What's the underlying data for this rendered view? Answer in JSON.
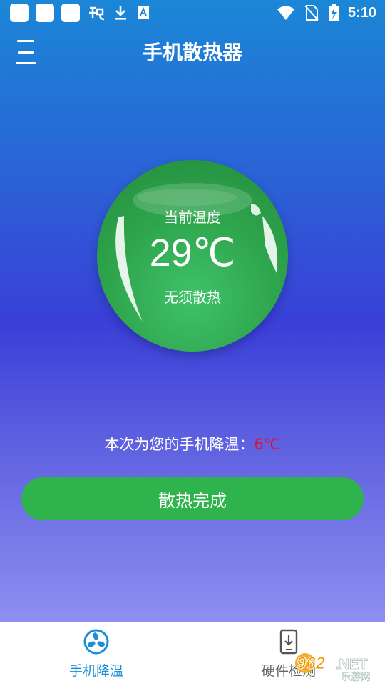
{
  "status_bar": {
    "time": "5:10",
    "left_icons": [
      "notification-box-icon",
      "notification-box-icon",
      "notification-box-icon",
      "bug-icon",
      "download-icon",
      "text-a-icon"
    ],
    "right_icons": [
      "wifi-icon",
      "no-sim-icon",
      "battery-charging-icon"
    ]
  },
  "header": {
    "title": "手机散热器",
    "menu_icon": "menu-icon"
  },
  "ball": {
    "label": "当前温度",
    "temperature": "29℃",
    "status": "无须散热"
  },
  "result": {
    "prefix": "本次为您的手机降温：",
    "value": "6℃",
    "value_color": "#e2102a"
  },
  "action": {
    "button_label": "散热完成",
    "button_color": "#2fb34c"
  },
  "bottom_nav": {
    "items": [
      {
        "label": "手机降温",
        "icon": "fan-icon",
        "active": true
      },
      {
        "label": "硬件检测",
        "icon": "phone-download-icon",
        "active": false
      }
    ],
    "active_color": "#1a8ed6"
  },
  "watermark": {
    "text_top": "962.NET",
    "text_bottom": "乐游网"
  }
}
